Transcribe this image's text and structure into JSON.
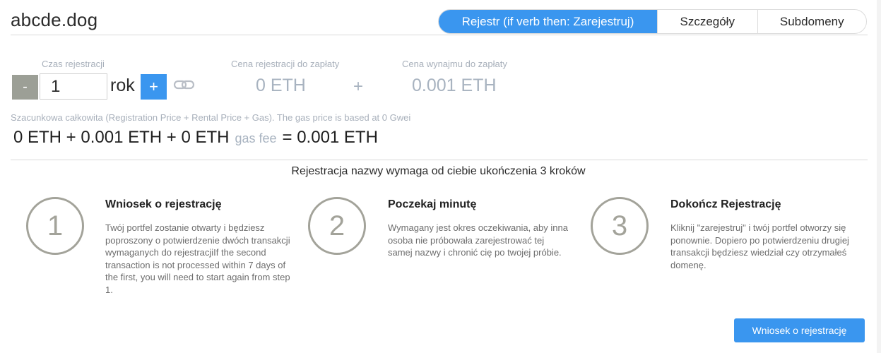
{
  "header": {
    "domain": "abcde.dog",
    "tabs": [
      {
        "label": "Rejestr (if verb then: Zarejestruj)",
        "active": true
      },
      {
        "label": "Szczegóły",
        "active": false
      },
      {
        "label": "Subdomeny",
        "active": false
      }
    ]
  },
  "registration": {
    "time_label": "Czas rejestracji",
    "minus_label": "-",
    "years_value": "1",
    "unit_label": "rok",
    "plus_label": "+",
    "reg_price_label": "Cena rejestracji do zapłaty",
    "reg_price_value": "0 ETH",
    "plus_sign": "+",
    "rent_price_label": "Cena wynajmu do zapłaty",
    "rent_price_value": "0.001 ETH"
  },
  "estimate": {
    "label": "Szacunkowa całkowita (Registration Price + Rental Price + Gas). The gas price is based at 0 Gwei",
    "part1": "0 ETH + 0.001 ETH + 0 ETH",
    "gas_label": "gas fee",
    "part2": "= 0.001 ETH"
  },
  "steps": {
    "title": "Rejestracja nazwy wymaga od ciebie ukończenia 3 kroków",
    "items": [
      {
        "number": "1",
        "title": "Wniosek o rejestrację",
        "description": "Twój portfel zostanie otwarty i będziesz poproszony o potwierdzenie dwóch transakcji wymaganych do rejestracjiIf the second transaction is not processed within 7 days of the first, you will need to start again from step 1."
      },
      {
        "number": "2",
        "title": "Poczekaj minutę",
        "description": "Wymagany jest okres oczekiwania, aby inna osoba nie próbowała zarejestrować tej samej nazwy i chronić cię po twojej próbie."
      },
      {
        "number": "3",
        "title": "Dokończ Rejestrację",
        "description": "Kliknij \"zarejestruj\" i twój portfel otworzy się ponownie. Dopiero po potwierdzeniu drugiej transakcji będziesz wiedział czy otrzymałeś domenę."
      }
    ]
  },
  "actions": {
    "submit_label": "Wniosek o rejestrację"
  },
  "colors": {
    "accent": "#3a96ef",
    "muted": "#a8b3c0",
    "circle": "#a3a39a"
  },
  "icons": {
    "link": "link-icon"
  }
}
